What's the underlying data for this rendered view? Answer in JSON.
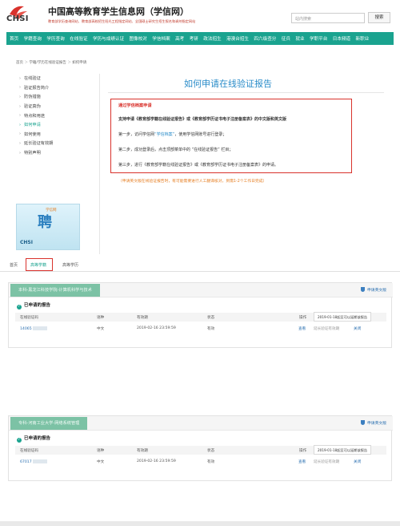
{
  "header": {
    "site_title": "中国高等教育学生信息网（学信网）",
    "logo_text": "CHSI",
    "subtitle": "教育部学历查询网站、教育部高校招生阳光工程指定网站、全国硕士研究生招生报名和调剂指定网站",
    "search_placeholder": "站内搜索",
    "search_button": "搜索"
  },
  "nav": [
    "首页",
    "学籍查询",
    "学历查询",
    "在线验证",
    "学历与成绩认证",
    "图像校对",
    "学信档案",
    "高考",
    "考研",
    "政法招生",
    "港澳台招生",
    "四六级查分",
    "征兵",
    "就业",
    "学职平台",
    "日本频道",
    "新职业"
  ],
  "breadcrumb": {
    "home": "首页",
    "sep1": "＞",
    "parent": "学籍/学历在线验证报告",
    "sep2": "＞",
    "current": "如何申请"
  },
  "sidebar": {
    "items": [
      {
        "label": "在线验证"
      },
      {
        "label": "验证报告简介"
      },
      {
        "label": "防伪措施"
      },
      {
        "label": "验证真伪"
      },
      {
        "label": "特点和用途"
      },
      {
        "label": "如何申请"
      },
      {
        "label": "如何使用"
      },
      {
        "label": "延长验证有效期"
      },
      {
        "label": "特别声明"
      }
    ],
    "active_index": 5,
    "banner": {
      "brand": "学信网",
      "big": "聘",
      "small": "CHSI"
    }
  },
  "main": {
    "title": "如何申请在线验证报告",
    "box_heading": "通过学信档案申请",
    "support_line": "支持申请《教育部学籍在线验证报告》或《教育部学历证书电子注册备案表》的中文版和英文版",
    "step1_a": "第一步，访问学信网",
    "step1_link": "“学信档案”",
    "step1_b": "，使用学信网账号进行登录；",
    "step2": "第二步，成功登录后，点击顶部菜单中的 “在线验证报告” 栏目；",
    "step3": "第三步，进行《教育部学籍在线验证报告》或《教育部学历证书电子注册备案表》的申请。",
    "note": "（申请英文版在线验证报告时，有可能需要进行人工翻译核对，到需1-2个工作日完成）"
  },
  "tabs": [
    "首页",
    "高等学籍",
    "高等学历"
  ],
  "active_tab": 1,
  "cards": [
    {
      "school": "本科-黑龙江科技学院-计算机科学与技术",
      "apply_en": "申请英文版",
      "section": "已申请的报告",
      "headers": [
        "在线验证码",
        "语种",
        "有效期",
        "状态",
        "操作"
      ],
      "tooltip": "2019-01-18起至可以延期该报告",
      "row": {
        "code": "14065",
        "lang": "中文",
        "expiry": "2019-02-16 23:59:59",
        "status": "有效",
        "view": "查看",
        "extend": "延长验证有效期",
        "close": "关闭"
      }
    },
    {
      "school": "专科-河南工业大学-网络系统管理",
      "apply_en": "申请英文版",
      "section": "已申请的报告",
      "headers": [
        "在线验证码",
        "语种",
        "有效期",
        "状态",
        "操作"
      ],
      "tooltip": "2019-01-18起至可以延期该报告",
      "row": {
        "code": "67017",
        "lang": "中文",
        "expiry": "2019-02-16 23:59:59",
        "status": "有效",
        "view": "查看",
        "extend": "延长验证有效期",
        "close": "关闭"
      }
    }
  ],
  "colors": {
    "accent": "#1aa38f",
    "highlight": "#d9322c",
    "link": "#2a8cc9"
  }
}
